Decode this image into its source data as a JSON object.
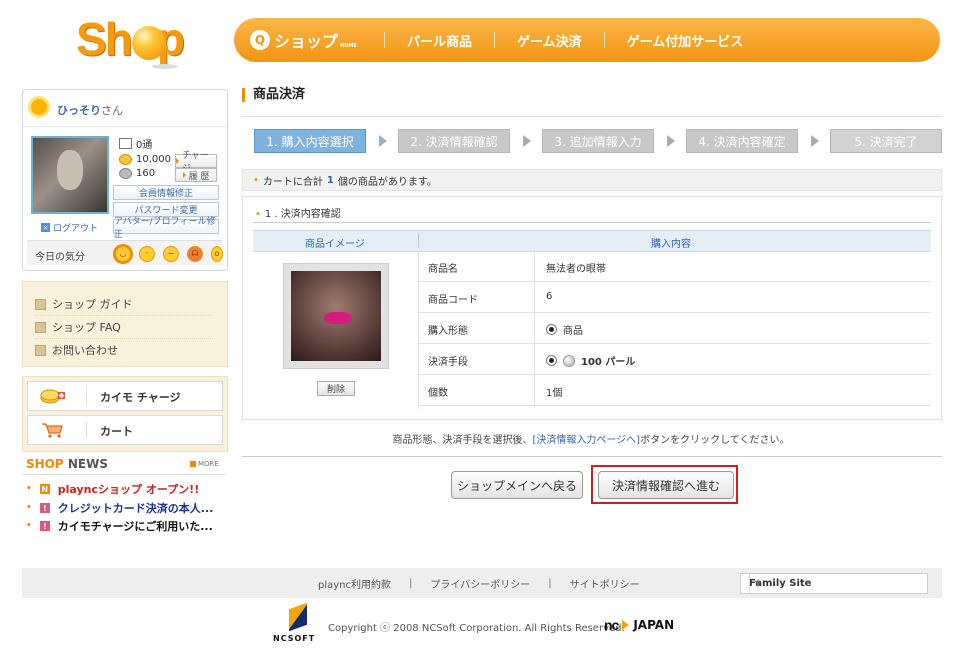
{
  "header": {
    "logo_text": "Shop",
    "nav_home": "ショップ",
    "nav_home_sub": "HOME",
    "nav_items": [
      "パール商品",
      "ゲーム決済",
      "ゲーム付加サービス"
    ],
    "brand_color": "#f39413"
  },
  "profile": {
    "username": "ひっそり",
    "honorific": "さん",
    "mail_count": "0通",
    "coin_balance": "10,000",
    "pearl_balance": "160",
    "charge_label": "チャージ",
    "history_label": "履 歴",
    "member_edit": "会員情報修正",
    "password_change": "パスワード変更",
    "avatar_edit": "アバター/プロフィール修正",
    "logout": "ログアウト",
    "mood_label": "今日の気分"
  },
  "guide": {
    "items": [
      "ショップ ガイド",
      "ショップ FAQ",
      "お問い合わせ"
    ]
  },
  "quick": {
    "charge": "カイモ チャージ",
    "cart": "カート"
  },
  "news": {
    "title_accent": "SHOP",
    "title_rest": "NEWS",
    "more": "MORE",
    "items": [
      {
        "tag": "N",
        "text": "playncショップ オープン!!",
        "color": "#cc1f1f",
        "tag_color": "#f08a00"
      },
      {
        "tag": "!",
        "text": "クレジットカード決済の本人...",
        "color": "#1a2f8f",
        "tag_color": "#e05585"
      },
      {
        "tag": "!",
        "text": "カイモチャージにご利用いた...",
        "color": "#111111",
        "tag_color": "#e05585"
      }
    ]
  },
  "main": {
    "page_title": "商品決済",
    "steps": [
      "1. 購入内容選択",
      "2. 決済情報確認",
      "3. 追加情報入力",
      "4. 決済内容確定",
      "5. 決済完了"
    ],
    "notice_prefix": "カートに合計",
    "notice_count": "1",
    "notice_suffix": "個の商品があります。",
    "section_title": "1 . 決済内容確認",
    "col_image": "商品イメージ",
    "col_content": "購入内容",
    "delete_label": "削除",
    "rows": [
      {
        "label": "商品名",
        "value": "無法者の眼帯"
      },
      {
        "label": "商品コード",
        "value": "6"
      },
      {
        "label": "購入形態",
        "value": "商品"
      },
      {
        "label": "決済手段",
        "value": "100 パール"
      },
      {
        "label": "個数",
        "value": "1個"
      }
    ],
    "help_prefix": "商品形態、決済手段を選択後、",
    "help_link": "[決済情報入力ページへ]",
    "help_suffix": "ボタンをクリックしてください。",
    "back_button": "ショップメインへ戻る",
    "next_button": "決済情報確認へ進む"
  },
  "footer": {
    "links": [
      "plaync利用約款",
      "プライバシーポリシー",
      "サイトポリシー"
    ],
    "family_site": "Family Site",
    "nc_logo_text": "NCSOFT",
    "copyright": "Copyright ⓒ 2008 NCSoft Corporation. All Rights Reserved.",
    "nc_japan": "JAPAN",
    "nc_mark": "nc"
  }
}
